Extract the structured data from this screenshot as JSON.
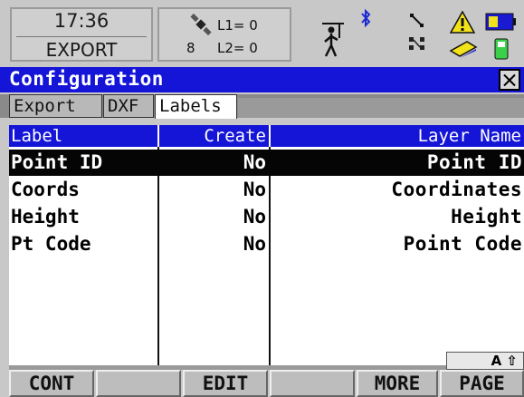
{
  "status": {
    "time": "17:36",
    "app_name": "EXPORT",
    "satellite_count": "8",
    "l1": "L1= 0",
    "l2": "L2= 0",
    "icons": [
      "satellite-icon",
      "person-icon",
      "bluetooth-icon",
      "link-icon",
      "link2-icon",
      "warning-icon",
      "card-icon",
      "battery-icon",
      "memory-icon"
    ]
  },
  "dialog": {
    "title": "Configuration"
  },
  "tabs": [
    {
      "label": "Export",
      "active": false
    },
    {
      "label": "DXF",
      "active": false
    },
    {
      "label": "Labels",
      "active": true
    }
  ],
  "table": {
    "columns": [
      "Label",
      "Create",
      "Layer Name"
    ],
    "rows": [
      {
        "label": "Point ID",
        "create": "No",
        "layer": "Point ID",
        "selected": true
      },
      {
        "label": "Coords",
        "create": "No",
        "layer": "Coordinates",
        "selected": false
      },
      {
        "label": "Height",
        "create": "No",
        "layer": "Height",
        "selected": false
      },
      {
        "label": "Pt Code",
        "create": "No",
        "layer": "Point Code",
        "selected": false
      }
    ]
  },
  "input_mode": "A ⇧",
  "fkeys": [
    "CONT",
    "",
    "EDIT",
    "",
    "MORE",
    "PAGE"
  ],
  "colors": {
    "title_bar": "#1515d8",
    "background": "#c8c8c8",
    "selected_row": "#050505"
  }
}
